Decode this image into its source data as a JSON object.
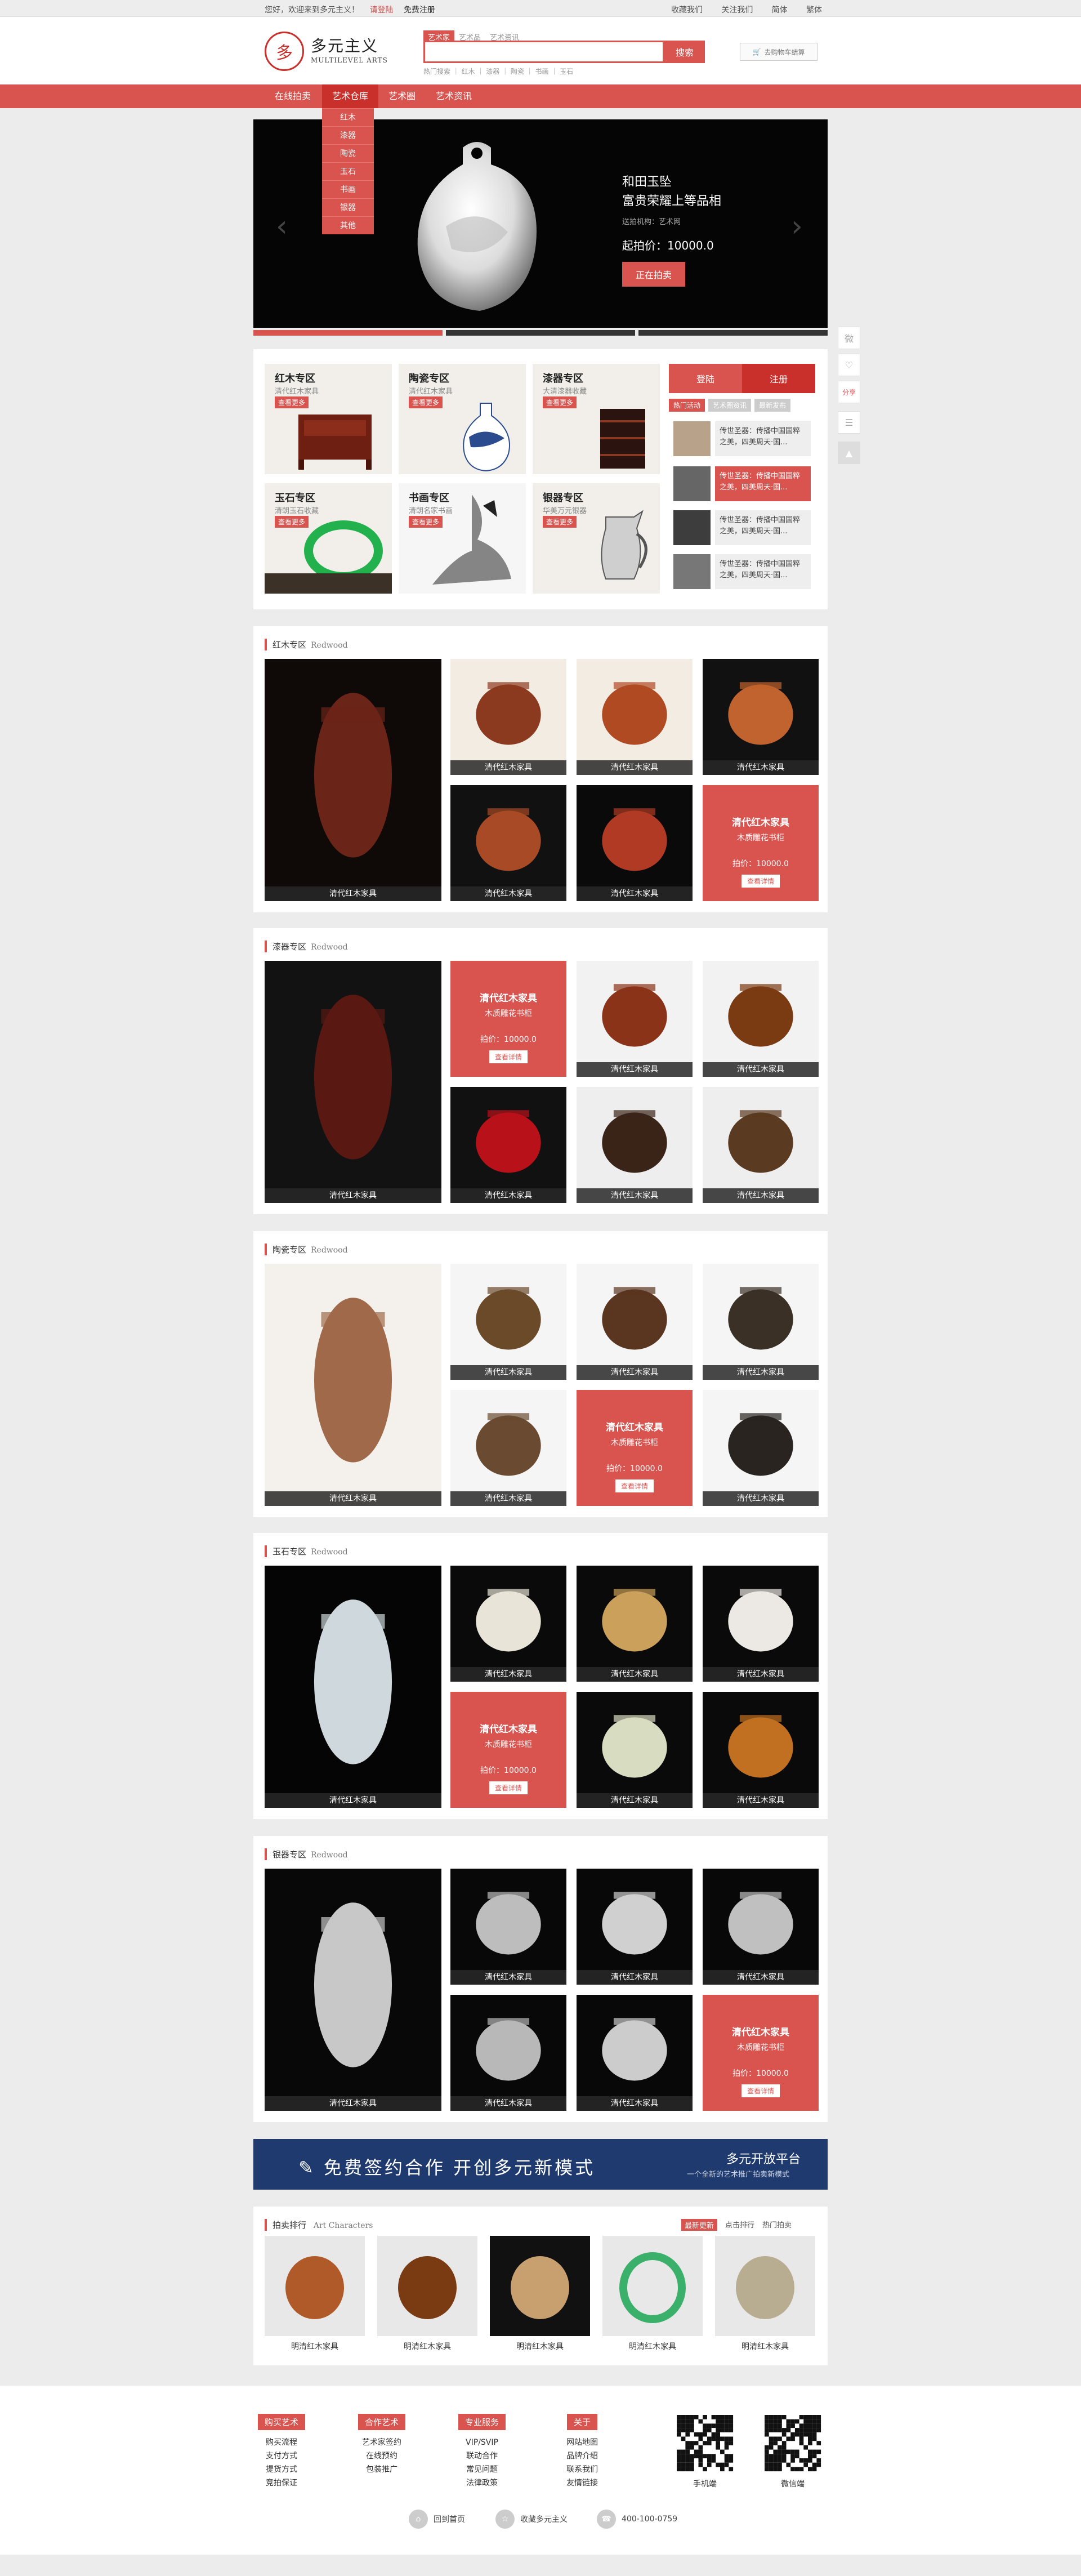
{
  "topbar": {
    "welcome": "您好，欢迎来到多元主义！",
    "login": "请登陆",
    "register": "免费注册",
    "right": [
      "收藏我们",
      "关注我们",
      "简体",
      "繁体"
    ]
  },
  "header": {
    "seal_text": "多",
    "logo_cn": "多元主义",
    "logo_en": "MULTILEVEL ARTS",
    "search_tabs": [
      "艺术家",
      "艺术品",
      "艺术资讯"
    ],
    "search_placeholder": "",
    "search_button": "搜索",
    "hot_words": "热门搜索 ｜ 红木 ｜ 漆器 ｜ 陶瓷 ｜ 书画 ｜ 玉石",
    "cart": "去购物车结算"
  },
  "nav": {
    "items": [
      "在线拍卖",
      "艺术仓库",
      "艺术圈",
      "艺术资讯"
    ]
  },
  "dropdown": [
    "红木",
    "漆器",
    "陶瓷",
    "玉石",
    "书画",
    "银器",
    "其他"
  ],
  "banner": {
    "title1": "和田玉坠",
    "title2": "富贵荣耀上等品相",
    "org": "送拍机构：艺术网",
    "price": "起拍价：10000.0",
    "button": "正在拍卖",
    "prev": "‹",
    "next": "›"
  },
  "categories": [
    {
      "title": "红木专区",
      "sub": "清代红木家具",
      "btn": "查看更多"
    },
    {
      "title": "陶瓷专区",
      "sub": "清代红木家具",
      "btn": "查看更多"
    },
    {
      "title": "漆器专区",
      "sub": "大清漆器收藏",
      "btn": "查看更多"
    },
    {
      "title": "玉石专区",
      "sub": "清朝玉石收藏",
      "btn": "查看更多"
    },
    {
      "title": "书画专区",
      "sub": "清朝名家书画",
      "btn": "查看更多"
    },
    {
      "title": "银器专区",
      "sub": "华美万元银器",
      "btn": "查看更多"
    }
  ],
  "login": {
    "login": "登陆",
    "register": "注册"
  },
  "hot_tabs": [
    "热门活动",
    "艺术圈资讯",
    "最新发布"
  ],
  "hot_items": [
    "传世圣器：传播中国国粹之美，四美周天·国...",
    "传世圣器：传播中国国粹之美，四美周天·国...",
    "传世圣器：传播中国国粹之美，四美周天·国...",
    "传世圣器：传播中国国粹之美，四美周天·国..."
  ],
  "sections": [
    {
      "title": "红木专区",
      "en": "Redwood"
    },
    {
      "title": "漆器专区",
      "en": "Redwood"
    },
    {
      "title": "陶瓷专区",
      "en": "Redwood"
    },
    {
      "title": "玉石专区",
      "en": "Redwood"
    },
    {
      "title": "银器专区",
      "en": "Redwood"
    }
  ],
  "tile_caption": "清代红木家具",
  "promo": {
    "p1": "清代红木家具",
    "p2": "木质雕花书柜",
    "p3": "拍价：10000.0",
    "p4": "查看详情"
  },
  "ad": {
    "a1": "✎ 免费签约合作 开创多元新模式",
    "a2": "多元开放平台",
    "a3": "一个全新的艺术推广拍卖新模式"
  },
  "ranking": {
    "title": "拍卖排行",
    "en": "Art Characters",
    "tabs": [
      "最新更新",
      "点击排行",
      "热门拍卖"
    ],
    "caption": "明清红木家具"
  },
  "footer": {
    "cols": [
      {
        "h": "购买艺术",
        "items": [
          "购买流程",
          "支付方式",
          "提货方式",
          "竞拍保证"
        ]
      },
      {
        "h": "合作艺术",
        "items": [
          "艺术家签约",
          "在线预约",
          "包装推广"
        ]
      },
      {
        "h": "专业服务",
        "items": [
          "VIP/SVIP",
          "联动合作",
          "常见问题",
          "法律政策"
        ]
      },
      {
        "h": "关于",
        "items": [
          "网站地图",
          "品牌介绍",
          "联系我们",
          "友情链接"
        ]
      }
    ],
    "qr": [
      "手机端",
      "微信端"
    ],
    "bottom": [
      "回到首页",
      "收藏多元主义",
      "400-100-0759"
    ]
  },
  "side": [
    "微",
    "♡",
    "分享",
    "☰",
    "▲"
  ]
}
